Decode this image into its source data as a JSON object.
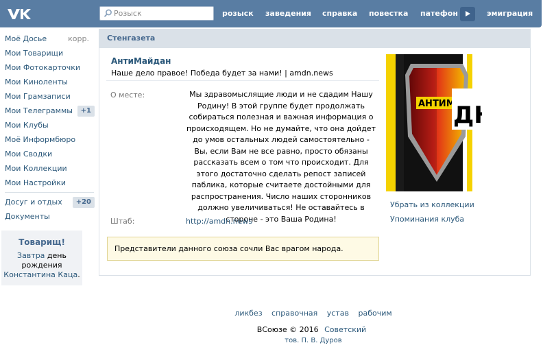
{
  "search": {
    "placeholder": "Розыск"
  },
  "nav": [
    "розыск",
    "заведения",
    "справка",
    "повестка",
    "патефон",
    "эмиграция"
  ],
  "menu": {
    "items": [
      "Моё Досье",
      "Мои Товарищи",
      "Мои Фотокарточки",
      "Мои Киноленты",
      "Мои Грамзаписи",
      "Мои Телеграммы",
      "Мои Клубы",
      "Моё Информбюро",
      "Мои Сводки",
      "Мои Коллекции",
      "Мои Настройки"
    ],
    "corr": "корр.",
    "telegrams_count": "+1",
    "leisure": "Досуг и отдых",
    "leisure_count": "+20",
    "documents": "Документы"
  },
  "birthday": {
    "title": "Товарищ!",
    "when": "Завтра",
    "text1": " день",
    "text2": "рождения",
    "person": "Константина Каца",
    "dot": "."
  },
  "panel": {
    "header": "Стенгазета",
    "club_name": "АнтиМайдан",
    "status": "Наше дело правое! Победа будет за нами! | amdn.news",
    "about_label": "О месте:",
    "about": "Мы здравомыслящие люди и не сдадим Нашу Родину! В этой группе будет продолжать собираться полезная и важная информация о происходящем. Но не думайте, что она дойдет до умов остальных людей самостоятельно - Вы, если Вам не все равно, просто обязаны рассказать всем о том что происходит. Для этого достаточно сделать репост записей паблика, которые считаете достойными для распространения. Число наших сторонников должно увеличиваться! Не оставайтесь в стороне - это Ваша Родина!",
    "hq_label": "Штаб:",
    "site": "http://amdn.news",
    "enemy": "Представители данного союза сочли Вас врагом народа.",
    "avatar_text_a": "АНТИМ",
    "avatar_text_b": "ДН",
    "remove": "Убрать из коллекции",
    "mentions": "Упоминания клуба"
  },
  "footer": {
    "links": [
      "ликбез",
      "справочная",
      "устав",
      "рабочим"
    ],
    "copyright": "ВСоюзе © 2016",
    "lang": "Советский",
    "author": "тов. П. В. Дуров"
  },
  "colors": {
    "topbar": "#597da3",
    "link": "#2b587a",
    "header_bg": "#dae1e8",
    "warning_bg": "#fefae5"
  }
}
